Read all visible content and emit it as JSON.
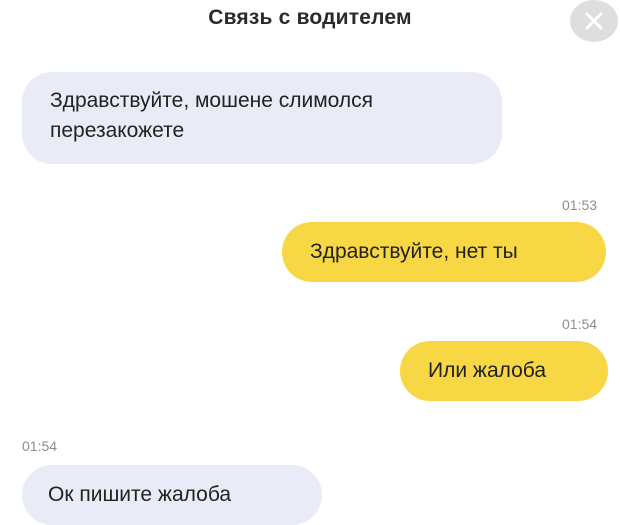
{
  "header": {
    "title": "Связь с водителем",
    "close_icon": "close-icon"
  },
  "messages": [
    {
      "direction": "incoming",
      "lines": [
        "Здравствуйте, мошене слимолся",
        "перезакожете"
      ],
      "time": ""
    },
    {
      "direction": "outgoing",
      "text": "Здравствуйте, нет ты",
      "time": "01:53"
    },
    {
      "direction": "outgoing",
      "text": "Или жалоба",
      "time": "01:54"
    },
    {
      "direction": "incoming",
      "text": "Ок пишите жалоба",
      "time": "01:54"
    }
  ],
  "colors": {
    "incoming_bubble": "#e9ecf6",
    "outgoing_bubble": "#f7d743",
    "timestamp": "#8e8e8e"
  }
}
